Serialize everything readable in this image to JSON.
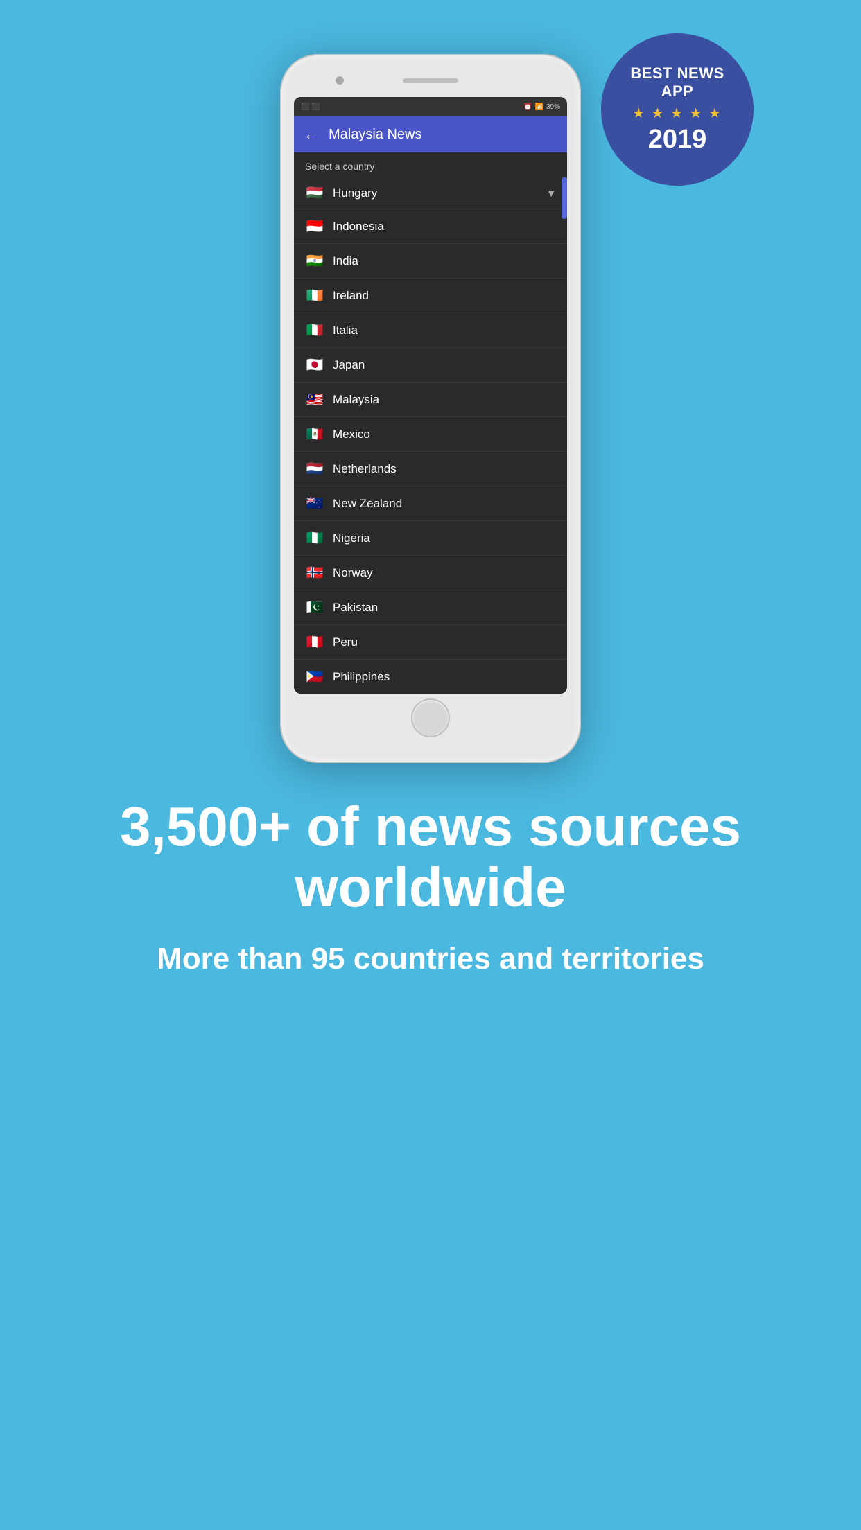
{
  "badge": {
    "line1": "BEST NEWS",
    "line2": "APP",
    "stars": "★ ★ ★ ★ ★",
    "year": "2019"
  },
  "app": {
    "back_label": "←",
    "title": "Malaysia News",
    "select_label": "Select a country",
    "dropdown_selected": "Hungary",
    "dropdown_arrow": "▼"
  },
  "countries": [
    {
      "flag": "🇮🇩",
      "name": "Indonesia"
    },
    {
      "flag": "🇮🇳",
      "name": "India"
    },
    {
      "flag": "🇮🇪",
      "name": "Ireland"
    },
    {
      "flag": "🇮🇹",
      "name": "Italia"
    },
    {
      "flag": "🇯🇵",
      "name": "Japan"
    },
    {
      "flag": "🇲🇾",
      "name": "Malaysia"
    },
    {
      "flag": "🇲🇽",
      "name": "Mexico"
    },
    {
      "flag": "🇳🇱",
      "name": "Netherlands"
    },
    {
      "flag": "🇳🇿",
      "name": "New Zealand"
    },
    {
      "flag": "🇳🇬",
      "name": "Nigeria"
    },
    {
      "flag": "🇳🇴",
      "name": "Norway"
    },
    {
      "flag": "🇵🇰",
      "name": "Pakistan"
    },
    {
      "flag": "🇵🇪",
      "name": "Peru"
    },
    {
      "flag": "🇵🇭",
      "name": "Philippines"
    }
  ],
  "stats": {
    "main": "3,500+ of news sources worldwide",
    "sub": "More than 95 countries and territories"
  },
  "status_bar": {
    "battery": "39%",
    "signal": "..ll"
  }
}
